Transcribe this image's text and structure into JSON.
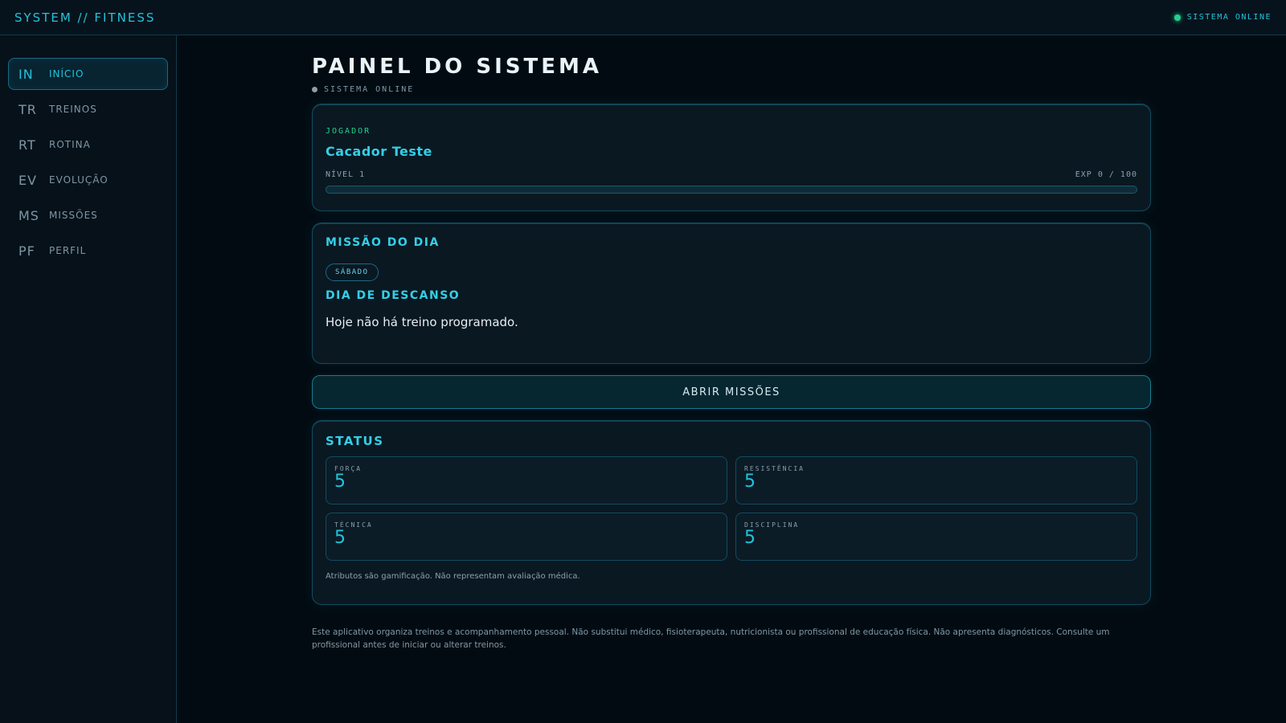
{
  "topbar": {
    "brand": "SYSTEM // FITNESS",
    "status": "SISTEMA ONLINE"
  },
  "sidebar": {
    "items": [
      {
        "abbr": "IN",
        "label": "INÍCIO",
        "active": true
      },
      {
        "abbr": "TR",
        "label": "TREINOS",
        "active": false
      },
      {
        "abbr": "RT",
        "label": "ROTINA",
        "active": false
      },
      {
        "abbr": "EV",
        "label": "EVOLUÇÃO",
        "active": false
      },
      {
        "abbr": "MS",
        "label": "MISSÕES",
        "active": false
      },
      {
        "abbr": "PF",
        "label": "PERFIL",
        "active": false
      }
    ]
  },
  "main": {
    "title": "PAINEL DO SISTEMA",
    "subtitle": "SISTEMA ONLINE",
    "player": {
      "label": "JOGADOR",
      "name": "Cacador Teste",
      "level": "NÍVEL 1",
      "exp": "EXP 0 / 100",
      "exp_progress": 0
    },
    "mission": {
      "title": "MISSÃO DO DIA",
      "day": "SÁBADO",
      "heading": "DIA DE DESCANSO",
      "text": "Hoje não há treino programado."
    },
    "open_missions_label": "ABRIR MISSÕES",
    "status": {
      "title": "STATUS",
      "stats": [
        {
          "label": "FORÇA",
          "value": "5"
        },
        {
          "label": "RESISTÊNCIA",
          "value": "5"
        },
        {
          "label": "TÉCNICA",
          "value": "5"
        },
        {
          "label": "DISCIPLINA",
          "value": "5"
        }
      ],
      "note": "Atributos são gamificação. Não representam avaliação médica."
    },
    "footer": "Este aplicativo organiza treinos e acompanhamento pessoal. Não substitui médico, fisioterapeuta, nutricionista ou profissional de educação física. Não apresenta diagnósticos. Consulte um profissional antes de iniciar ou alterar treinos."
  },
  "colors": {
    "accent": "#22c3dc",
    "online": "#23d18b",
    "background": "#030b12"
  }
}
